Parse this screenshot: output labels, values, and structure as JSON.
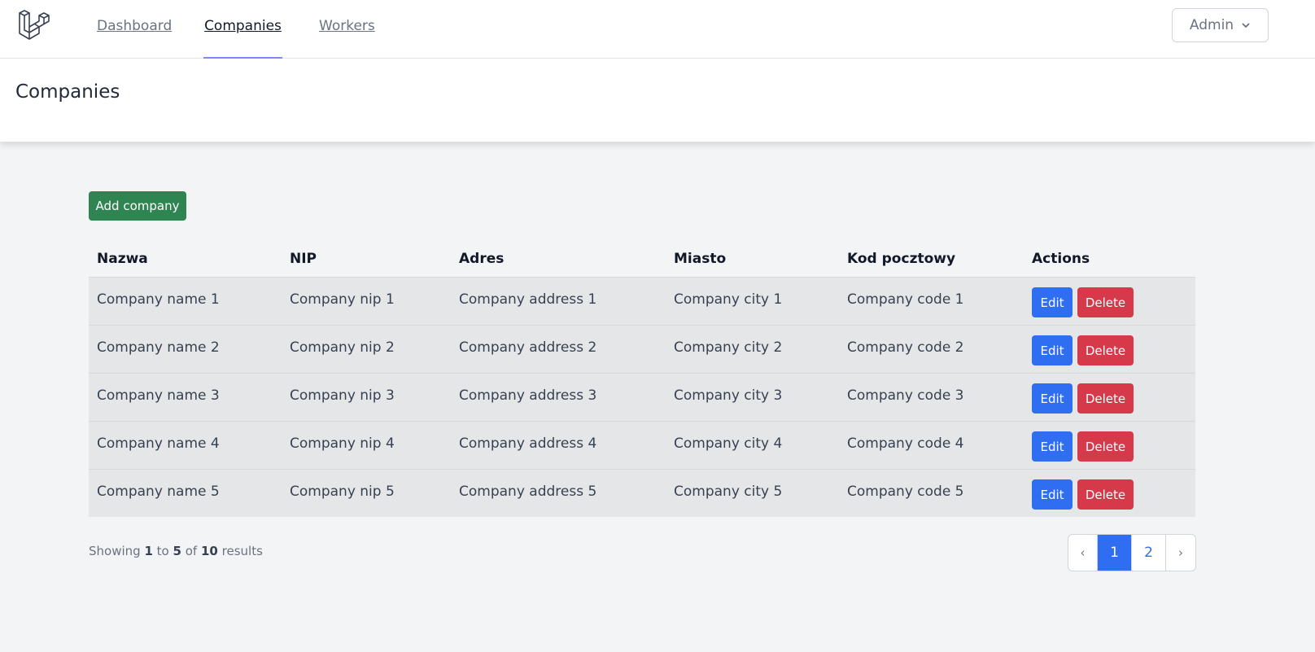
{
  "nav": {
    "links": [
      {
        "label": "Dashboard"
      },
      {
        "label": "Companies"
      },
      {
        "label": "Workers"
      }
    ],
    "user_label": "Admin"
  },
  "header": {
    "title": "Companies"
  },
  "add_button_label": "Add company",
  "table": {
    "columns": [
      "Nazwa",
      "NIP",
      "Adres",
      "Miasto",
      "Kod pocztowy",
      "Actions"
    ],
    "rows": [
      [
        "Company name 1",
        "Company nip 1",
        "Company address 1",
        "Company city 1",
        "Company code 1"
      ],
      [
        "Company name 2",
        "Company nip 2",
        "Company address 2",
        "Company city 2",
        "Company code 2"
      ],
      [
        "Company name 3",
        "Company nip 3",
        "Company address 3",
        "Company city 3",
        "Company code 3"
      ],
      [
        "Company name 4",
        "Company nip 4",
        "Company address 4",
        "Company city 4",
        "Company code 4"
      ],
      [
        "Company name 5",
        "Company nip 5",
        "Company address 5",
        "Company city 5",
        "Company code 5"
      ]
    ],
    "edit_label": "Edit",
    "delete_label": "Delete"
  },
  "pagination": {
    "showing_prefix": "Showing",
    "from": "1",
    "to_word": "to",
    "to": "5",
    "of_word": "of",
    "total": "10",
    "results_word": "results",
    "prev": "‹",
    "pages": [
      "1",
      "2"
    ],
    "next": "›"
  },
  "colors": {
    "primary": "#2f6ef0",
    "success": "#2f8552",
    "danger": "#d63a4a",
    "active_tab_underline": "#818cf8"
  }
}
